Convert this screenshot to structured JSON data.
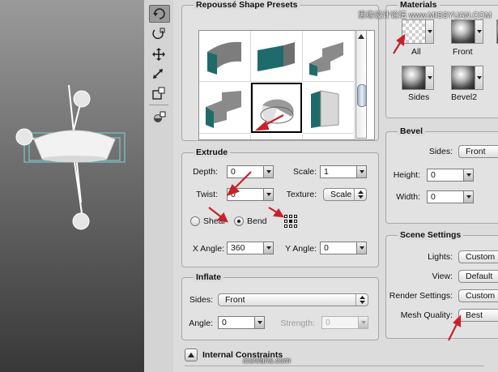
{
  "watermark_top": "思缘设计论坛 www.MISSYUAN.COM",
  "watermark_bottom": "iconfans.com",
  "presets": {
    "title": "Repoussé Shape Presets",
    "colors": {
      "face": "#1f6b6b",
      "side": "#8a8a8a"
    }
  },
  "extrude": {
    "title": "Extrude",
    "depth_label": "Depth:",
    "depth_value": "0",
    "scale_label": "Scale:",
    "scale_value": "1",
    "twist_label": "Twist:",
    "twist_value": "0",
    "texture_label": "Texture:",
    "texture_value": "Scale",
    "shear_label": "Shear",
    "bend_label": "Bend",
    "selected_mode": "bend",
    "xangle_label": "X Angle:",
    "xangle_value": "360",
    "yangle_label": "Y Angle:",
    "yangle_value": "0"
  },
  "inflate": {
    "title": "Inflate",
    "sides_label": "Sides:",
    "sides_value": "Front",
    "angle_label": "Angle:",
    "angle_value": "0",
    "strength_label": "Strength:",
    "strength_value": "0"
  },
  "internal_constraints": {
    "title": "Internal Constraints"
  },
  "materials": {
    "title": "Materials",
    "items": [
      {
        "label": "All",
        "kind": "checker"
      },
      {
        "label": "Front",
        "kind": "sphere"
      },
      {
        "label": "Sides",
        "kind": "sphere"
      },
      {
        "label": "Bevel2",
        "kind": "sphere"
      }
    ]
  },
  "bevel": {
    "title": "Bevel",
    "sides_label": "Sides:",
    "sides_value": "Front",
    "height_label": "Height:",
    "height_value": "0",
    "width_label": "Width:",
    "width_value": "0"
  },
  "scene": {
    "title": "Scene Settings",
    "lights_label": "Lights:",
    "lights_value": "Custom",
    "view_label": "View:",
    "view_value": "Default",
    "render_label": "Render Settings:",
    "render_value": "Custom",
    "mesh_label": "Mesh Quality:",
    "mesh_value": "Best"
  },
  "colors": {
    "annotation_arrow": "#c8202a",
    "mesh_wire": "#7fd6d6"
  }
}
